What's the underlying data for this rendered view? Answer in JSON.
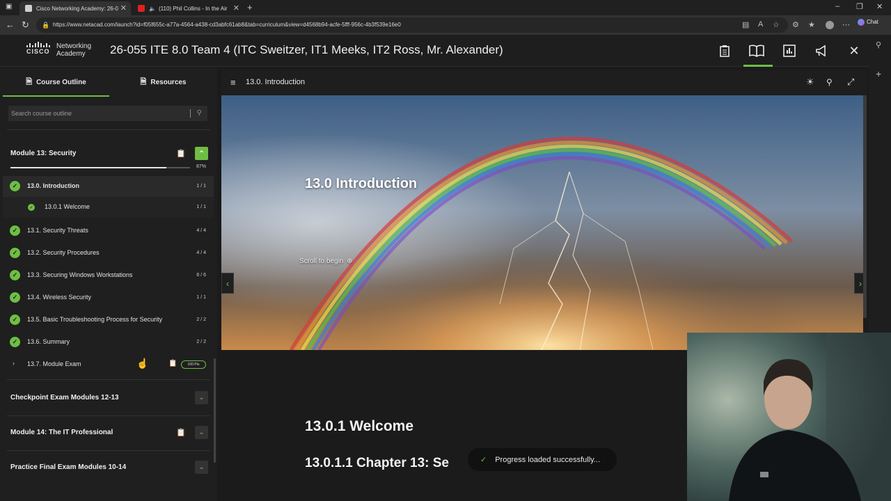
{
  "browser": {
    "tabs": [
      {
        "title": "Cisco Networking Academy: 26-0",
        "active": true
      },
      {
        "title": "(110) Phil Collins - In the Air",
        "active": false
      }
    ],
    "url": "https://www.netacad.com/launch?id=f05f655c-a77a-4564-a438-cd3abfc61ab8&tab=curriculum&view=d4568b94-acfe-5fff-956c-4b3f539e16e0",
    "chat_label": "Chat"
  },
  "header": {
    "logo_top": "Networking",
    "logo_bottom": "Academy",
    "logo_brand": "CISCO",
    "course_title": "26-055 ITE 8.0 Team 4 (ITC Sweitzer, IT1 Meeks, IT2 Ross, Mr. Alexander)"
  },
  "sidebar": {
    "tabs": {
      "outline": "Course Outline",
      "resources": "Resources"
    },
    "search_placeholder": "Search course outline",
    "module13": {
      "title": "Module 13: Security",
      "progress_label": "87%",
      "progress": 0.87,
      "items": [
        {
          "label": "13.0. Introduction",
          "count": "1 / 1"
        },
        {
          "label": "13.0.1 Welcome",
          "count": "1 / 1"
        },
        {
          "label": "13.1. Security Threats",
          "count": "4 / 4"
        },
        {
          "label": "13.2. Security Procedures",
          "count": "4 / 4"
        },
        {
          "label": "13.3. Securing Windows Workstations",
          "count": "6 / 6"
        },
        {
          "label": "13.4. Wireless Security",
          "count": "1 / 1"
        },
        {
          "label": "13.5. Basic Troubleshooting Process for Security",
          "count": "2 / 2"
        },
        {
          "label": "13.6. Summary",
          "count": "2 / 2"
        },
        {
          "label": "13.7. Module Exam",
          "count": "100 Pts"
        }
      ]
    },
    "other_modules": [
      {
        "title": "Checkpoint Exam Modules 12-13"
      },
      {
        "title": "Module 14: The IT Professional"
      },
      {
        "title": "Practice Final Exam Modules 10-14"
      }
    ]
  },
  "content": {
    "breadcrumb": "13.0. Introduction",
    "hero_title": "13.0 Introduction",
    "scroll_hint": "Scroll to begin",
    "section_title": "13.0.1 Welcome",
    "subsection_title": "13.0.1.1 Chapter 13: Se",
    "toast": "Progress loaded successfully..."
  },
  "colors": {
    "accent": "#6ebe44",
    "background": "#1b1b1b"
  }
}
